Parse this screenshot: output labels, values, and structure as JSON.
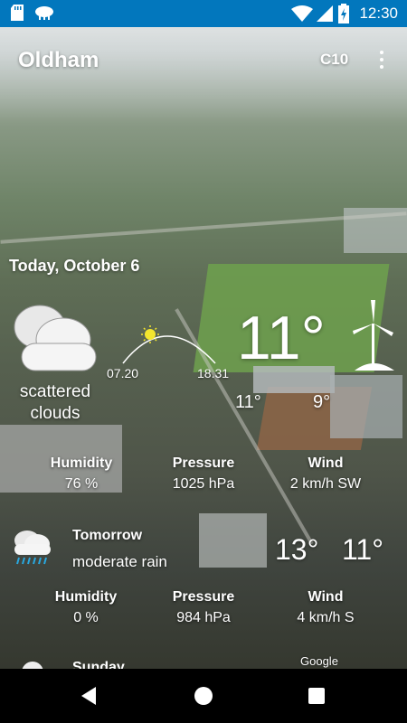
{
  "status_bar": {
    "time": "12:30",
    "icons": [
      "sd-card-icon",
      "weather-notification-icon",
      "wifi-icon",
      "battery-charging-icon"
    ]
  },
  "header": {
    "city": "Oldham",
    "unit": "C10",
    "menu_icon": "overflow-menu-icon"
  },
  "today": {
    "date": "Today, October 6",
    "condition": "scattered clouds",
    "icon": "cloud-icon",
    "sunrise": "07.20",
    "sunset": "18.31",
    "temp": "11°",
    "temp_max": "11°",
    "temp_min": "9°",
    "humidity_label": "Humidity",
    "humidity": "76 %",
    "pressure_label": "Pressure",
    "pressure": "1025 hPa",
    "wind_label": "Wind",
    "wind": "2 km/h SW"
  },
  "tomorrow": {
    "day": "Tomorrow",
    "condition": "moderate rain",
    "icon": "rain-cloud-icon",
    "temp_max": "13°",
    "temp_min": "11°",
    "humidity_label": "Humidity",
    "humidity": "0 %",
    "pressure_label": "Pressure",
    "pressure": "984 hPa",
    "wind_label": "Wind",
    "wind": "4 km/h S"
  },
  "next": {
    "day": "Sunday"
  },
  "map_attribution": "Google",
  "nav": {
    "back": "back-icon",
    "home": "home-icon",
    "recents": "recents-icon"
  }
}
